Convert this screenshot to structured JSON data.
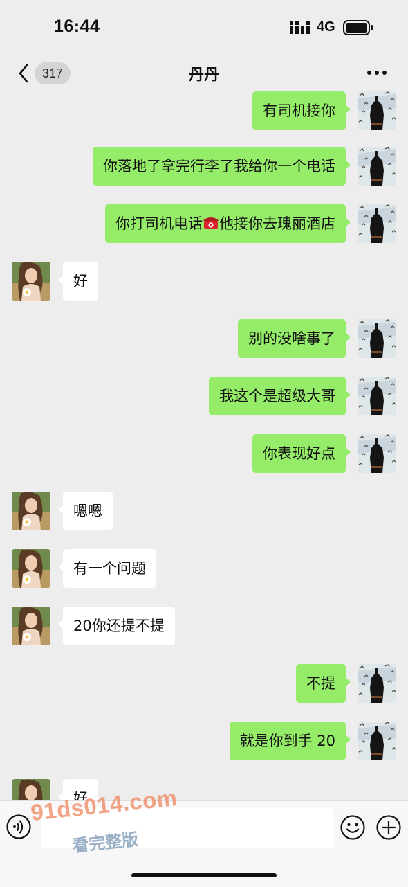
{
  "status_bar": {
    "time": "16:44",
    "network": "4G",
    "icons": [
      "signal-icon",
      "battery-icon"
    ]
  },
  "nav": {
    "unread_count": "317",
    "title": "丹丹",
    "icons": [
      "chevron-left-icon",
      "more-icon"
    ]
  },
  "messages": [
    {
      "from": "me",
      "text": "有司机接你"
    },
    {
      "from": "me",
      "text": "你落地了拿完行李了我给你一个电话"
    },
    {
      "from": "me",
      "text_before": "你打司机电话",
      "emoji": "telephone-emoji",
      "text_after": "他接你去瑰丽酒店"
    },
    {
      "from": "them",
      "text": "好"
    },
    {
      "from": "me",
      "text": "别的没啥事了"
    },
    {
      "from": "me",
      "text": "我这个是超级大哥"
    },
    {
      "from": "me",
      "text": "你表现好点"
    },
    {
      "from": "them",
      "text": "嗯嗯"
    },
    {
      "from": "them",
      "text": "有一个问题"
    },
    {
      "from": "them",
      "text": "20你还提不提"
    },
    {
      "from": "me",
      "text": "不提"
    },
    {
      "from": "me",
      "text": "就是你到手 20"
    },
    {
      "from": "them",
      "text": "好"
    }
  ],
  "input_bar": {
    "placeholder": "",
    "icons": [
      "voice-icon",
      "emoji-icon",
      "plus-icon"
    ]
  },
  "watermark": {
    "url": "91ds014.com",
    "cta": "看完整版"
  },
  "colors": {
    "background": "#ededed",
    "my_bubble": "#95ec69",
    "their_bubble": "#ffffff",
    "watermark_url": "#f08a64"
  }
}
